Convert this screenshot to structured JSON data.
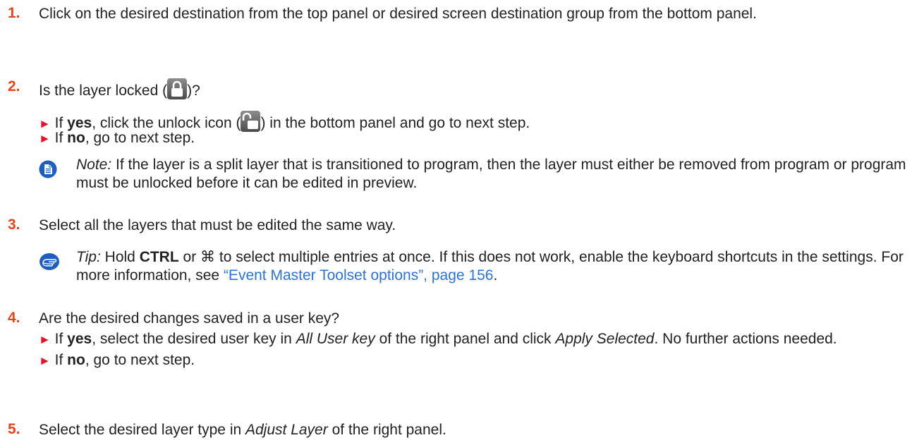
{
  "colors": {
    "step_number": "#e8431a",
    "bullet_arrow": "#e8102a",
    "link": "#2d72d9",
    "note_icon": "#1c5fbe"
  },
  "step1": {
    "number": "1.",
    "text": "Click on the desired destination from the top panel or desired screen destination group from the bottom panel."
  },
  "step2": {
    "number": "2.",
    "q_before": "Is the layer locked (",
    "q_after": ")?",
    "lock_icon": "lock-icon",
    "bullet_arrow": "►",
    "bullet1_a": " If ",
    "bullet1_b": "yes",
    "bullet1_c": ", click the unlock icon (",
    "unlock_icon": "unlock-icon",
    "bullet1_d": ") in the bottom panel and go to next step.",
    "bullet2_a": " If ",
    "bullet2_b": "no",
    "bullet2_c": ", go to next step.",
    "note_icon": "note-document-icon",
    "note_label": "Note:",
    "note_text": " If the layer is a split layer that is transitioned to program, then the layer must either be removed from program or program must be unlocked before it can be edited in preview."
  },
  "step3": {
    "number": "3.",
    "text": "Select all the layers that must be edited the same way.",
    "tip_icon": "pointing-hand-icon",
    "tip_label": "Tip:",
    "tip_a": " Hold ",
    "tip_ctrl": "CTRL",
    "tip_b": " or ⌘ to select multiple entries at once. If this does not work, enable the keyboard shortcuts in the settings. For more information, see ",
    "tip_link": "“Event Master Toolset options”, page 156",
    "tip_c": "."
  },
  "step4": {
    "number": "4.",
    "text": "Are the desired changes saved in a user key?",
    "bullet_arrow": "►",
    "b1_a": " If ",
    "b1_b": "yes",
    "b1_c": ", select the desired user key in ",
    "b1_d": "All User key",
    "b1_e": " of the right panel and click ",
    "b1_f": "Apply Selected",
    "b1_g": ". No further actions needed.",
    "b2_a": " If ",
    "b2_b": "no",
    "b2_c": ", go to next step."
  },
  "step5": {
    "number": "5.",
    "text_a": "Select the desired layer type in ",
    "text_b": "Adjust Layer",
    "text_c": " of the right panel."
  }
}
